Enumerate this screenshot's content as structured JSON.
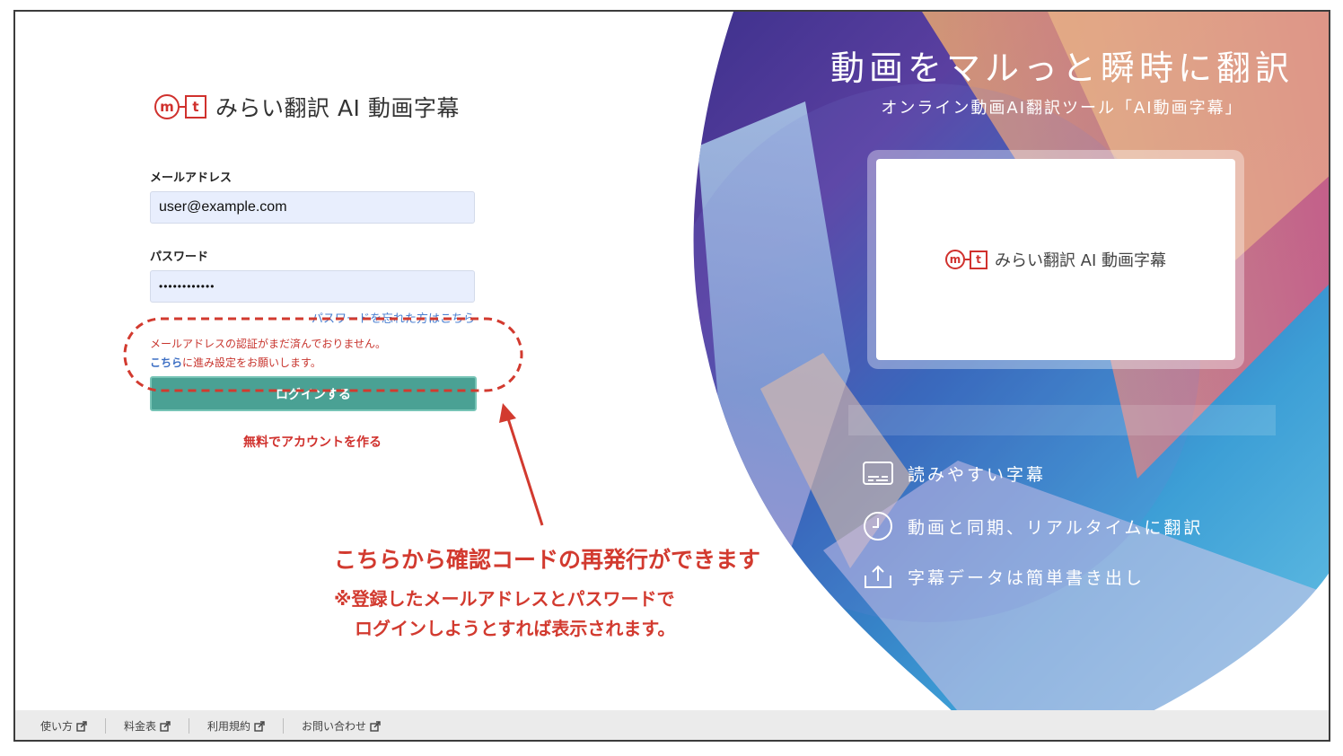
{
  "brand": {
    "logo_m": "m",
    "logo_t": "t",
    "name": "みらい翻訳 AI 動画字幕"
  },
  "hero": {
    "title": "動画をマルっと瞬時に翻訳",
    "subtitle": "オンライン動画AI翻訳ツール「AI動画字幕」",
    "preview_brand": "みらい翻訳 AI 動画字幕",
    "features": [
      {
        "icon": "subtitles-icon",
        "label": "読みやすい字幕"
      },
      {
        "icon": "clock-icon",
        "label": "動画と同期、リアルタイムに翻訳"
      },
      {
        "icon": "upload-icon",
        "label": "字幕データは簡単書き出し"
      }
    ]
  },
  "form": {
    "email_label": "メールアドレス",
    "email_value": "user@example.com",
    "password_label": "パスワード",
    "password_value": "••••••••••••",
    "forgot_link": "パスワードを忘れた方はこちら",
    "error_line1": "メールアドレスの認証がまだ済んでおりません。",
    "error_link": "こちら",
    "error_line2_rest": "に進み設定をお願いします。",
    "login_button": "ログインする",
    "signup_link": "無料でアカウントを作る"
  },
  "annotation": {
    "line1": "こちらから確認コードの再発行ができます",
    "line2": "※登録したメールアドレスとパスワードで",
    "line3": "ログインしようとすれば表示されます。",
    "color": "#d23a2f"
  },
  "footer": {
    "items": [
      {
        "label": "使い方",
        "icon": "external-link-icon"
      },
      {
        "label": "料金表",
        "icon": "external-link-icon"
      },
      {
        "label": "利用規約",
        "icon": "external-link-icon"
      },
      {
        "label": "お問い合わせ",
        "icon": "external-link-icon"
      }
    ]
  },
  "colors": {
    "accent_red": "#d0312d",
    "button_teal": "#4aa194",
    "link_blue": "#4a7fd0"
  }
}
